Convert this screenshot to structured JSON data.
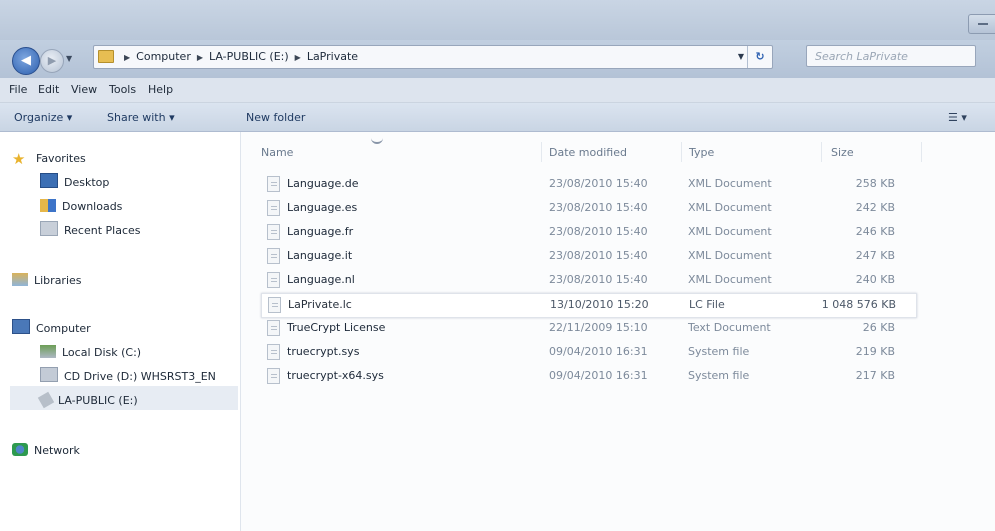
{
  "address": {
    "crumbs": [
      "Computer",
      "LA-PUBLIC (E:)",
      "LaPrivate"
    ],
    "search_placeholder": "Search LaPrivate"
  },
  "menu": [
    "File",
    "Edit",
    "View",
    "Tools",
    "Help"
  ],
  "commands": {
    "organize": "Organize ▾",
    "share": "Share with ▾",
    "new_folder": "New folder"
  },
  "nav": {
    "favorites": "Favorites",
    "desktop": "Desktop",
    "downloads": "Downloads",
    "recent": "Recent Places",
    "libraries": "Libraries",
    "computer": "Computer",
    "local_disk": "Local Disk (C:)",
    "cd_drive": "CD Drive (D:) WHSRST3_EN",
    "la_public": "LA-PUBLIC (E:)",
    "network": "Network"
  },
  "columns": {
    "name": "Name",
    "date": "Date modified",
    "type": "Type",
    "size": "Size"
  },
  "files": [
    {
      "name": "Language.de",
      "date": "23/08/2010 15:40",
      "type": "XML Document",
      "size": "258 KB"
    },
    {
      "name": "Language.es",
      "date": "23/08/2010 15:40",
      "type": "XML Document",
      "size": "242 KB"
    },
    {
      "name": "Language.fr",
      "date": "23/08/2010 15:40",
      "type": "XML Document",
      "size": "246 KB"
    },
    {
      "name": "Language.it",
      "date": "23/08/2010 15:40",
      "type": "XML Document",
      "size": "247 KB"
    },
    {
      "name": "Language.nl",
      "date": "23/08/2010 15:40",
      "type": "XML Document",
      "size": "240 KB"
    },
    {
      "name": "LaPrivate.lc",
      "date": "13/10/2010 15:20",
      "type": "LC File",
      "size": "1 048 576 KB"
    },
    {
      "name": "TrueCrypt License",
      "date": "22/11/2009 15:10",
      "type": "Text Document",
      "size": "26 KB"
    },
    {
      "name": "truecrypt.sys",
      "date": "09/04/2010 16:31",
      "type": "System file",
      "size": "219 KB"
    },
    {
      "name": "truecrypt-x64.sys",
      "date": "09/04/2010 16:31",
      "type": "System file",
      "size": "217 KB"
    }
  ]
}
